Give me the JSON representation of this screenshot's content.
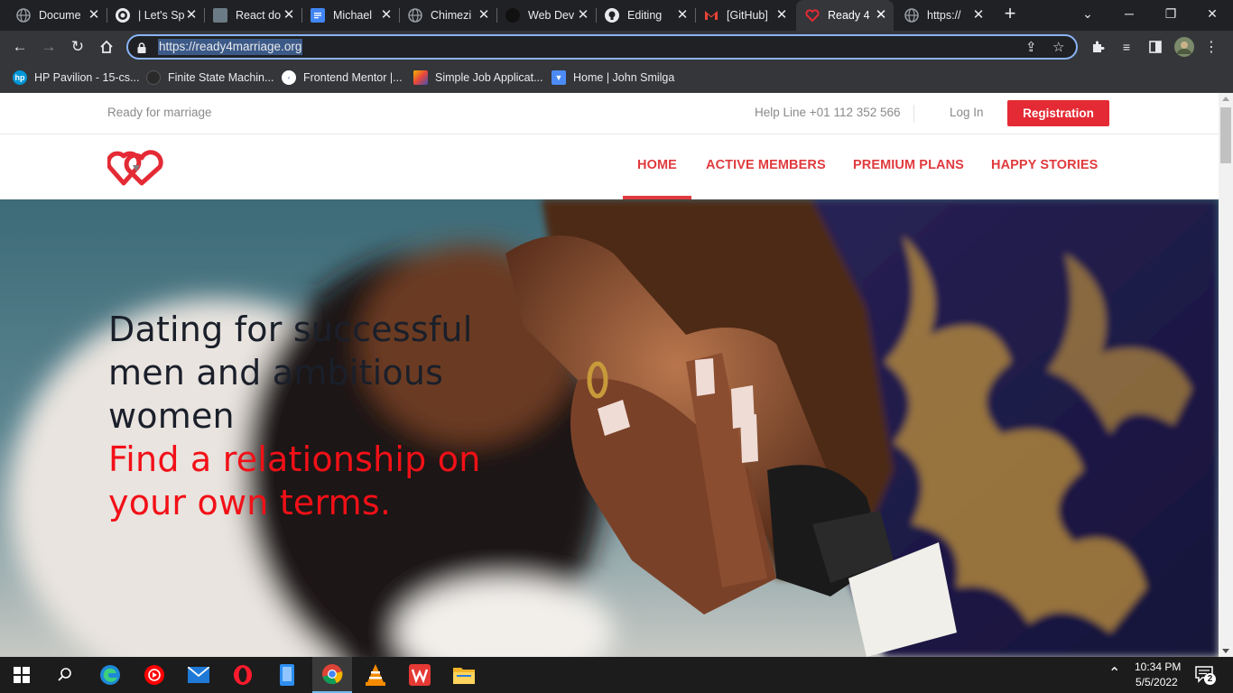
{
  "tabs": [
    {
      "title": "Docume",
      "icon": "globe-icon"
    },
    {
      "title": "| Let's Sp",
      "icon": "chrome-app-icon"
    },
    {
      "title": "React do",
      "icon": "page-icon"
    },
    {
      "title": "Michael",
      "icon": "docs-icon"
    },
    {
      "title": "Chimezi",
      "icon": "globe-icon"
    },
    {
      "title": "Web Dev",
      "icon": "dark-globe-icon"
    },
    {
      "title": "Editing",
      "icon": "github-icon"
    },
    {
      "title": "[GitHub]",
      "icon": "gmail-icon"
    },
    {
      "title": "Ready 4",
      "icon": "heart-icon",
      "active": true
    },
    {
      "title": "https://",
      "icon": "globe-icon"
    }
  ],
  "address_bar": {
    "url": "https://ready4marriage.org"
  },
  "bookmarks": [
    {
      "label": "HP Pavilion - 15-cs...",
      "icon": "hp-icon"
    },
    {
      "label": "Finite State Machin...",
      "icon": "fsm-icon"
    },
    {
      "label": "Frontend Mentor |...",
      "icon": "frontend-mentor-icon"
    },
    {
      "label": "Simple Job Applicat...",
      "icon": "job-app-icon"
    },
    {
      "label": "Home | John Smilga",
      "icon": "smilga-icon"
    }
  ],
  "site": {
    "tagline": "Ready for marriage",
    "help_line": "Help Line +01 112 352 566",
    "login": "Log In",
    "registration": "Registration",
    "nav": [
      "HOME",
      "ACTIVE MEMBERS",
      "PREMIUM PLANS",
      "HAPPY STORIES"
    ],
    "active_nav": "HOME",
    "hero": {
      "line1": "Dating for successful",
      "line2": "men and ambitious",
      "line3": "women",
      "line4": "Find a relationship on",
      "line5": "your own terms."
    }
  },
  "colors": {
    "brand_red": "#e42a34",
    "hero_accent": "#f21017"
  },
  "taskbar": {
    "apps": [
      "windows-start-icon",
      "search-icon",
      "edge-icon",
      "youtube-music-icon",
      "mail-icon",
      "opera-icon",
      "phone-app-icon",
      "chrome-icon",
      "vlc-icon",
      "wps-icon",
      "file-explorer-icon"
    ],
    "time": "10:34 PM",
    "date": "5/5/2022",
    "notifications": "2"
  }
}
